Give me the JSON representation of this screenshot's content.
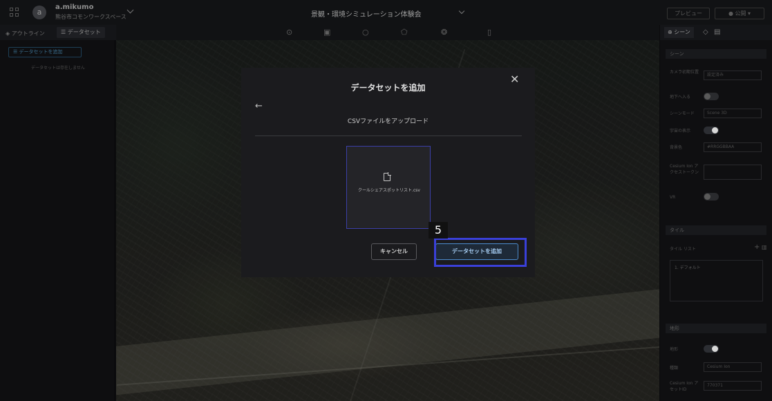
{
  "topbar": {
    "avatar_letter": "a",
    "user_name": "a.mikumo",
    "workspace_name": "熊谷市コモンワークスペース",
    "project_title": "景観・環境シミュレーション体験会",
    "preview_label": "プレビュー",
    "publish_label": "● 公開 ▾"
  },
  "left_panel": {
    "tabs": [
      {
        "icon": "layers-icon",
        "label": "アウトライン"
      },
      {
        "icon": "database-icon",
        "label": "データセット"
      }
    ],
    "add_dataset_label": "データセットを追加",
    "empty_message": "データセットは存在しません"
  },
  "toolbar": {
    "tools": [
      "map-pin-icon",
      "image-icon",
      "circle-icon",
      "polygon-icon",
      "model-icon",
      "file-icon"
    ]
  },
  "right_panel": {
    "tab_scene": "シーン",
    "scene_section": "シーン",
    "camera_label": "カメラ初期位置",
    "camera_value": "設定済み",
    "underground_label": "地下へ入る",
    "scene_mode_label": "シーンモード",
    "scene_mode_value": "Scene 3D",
    "space_label": "宇宙の表示",
    "bg_color_label": "背景色",
    "bg_color_value": "#RRGGBBAA",
    "cesium_token_label": "Cesium Ion アクセストークン",
    "vr_label": "VR",
    "tile_section": "タイル",
    "tile_list_label": "タイル リスト",
    "tile_item": "1. デフォルト",
    "terrain_section": "地形",
    "terrain_label": "地形",
    "type_label": "種類",
    "type_value": "Cesium Ion",
    "asset_id_label": "Cesium Ion アセットID",
    "asset_id_value": "770371"
  },
  "modal": {
    "title": "データセットを追加",
    "subtitle": "CSVファイルをアップロード",
    "file_name": "クールシェアスポットリスト.csv",
    "cancel_label": "キャンセル",
    "add_label": "データセットを追加"
  },
  "annotation": {
    "step_number": "5",
    "highlight_color": "#3a40d9"
  }
}
